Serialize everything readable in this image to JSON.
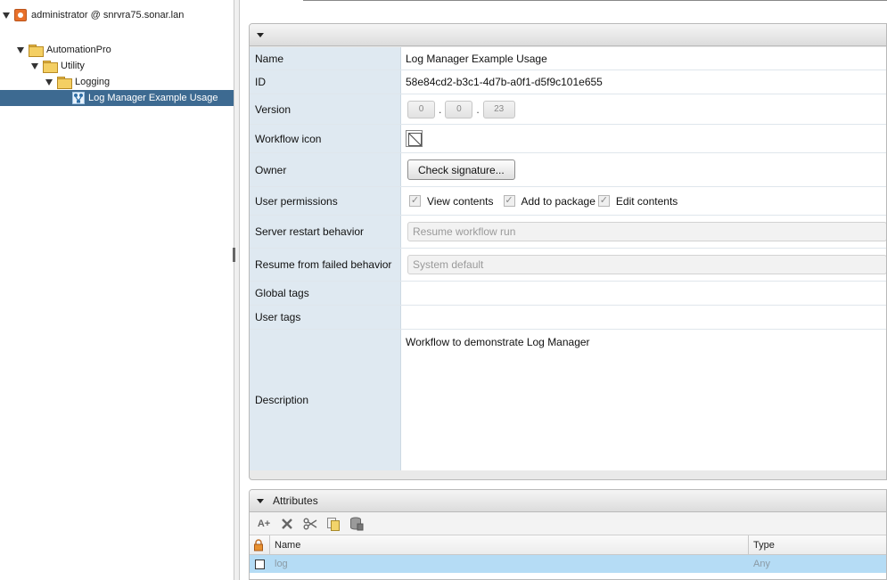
{
  "tree": {
    "root": "administrator @ snrvra75.sonar.lan",
    "items": [
      {
        "label": "AutomationPro"
      },
      {
        "label": "Utility"
      },
      {
        "label": "Logging"
      },
      {
        "label": "Log Manager Example Usage"
      }
    ]
  },
  "general": {
    "rows": [
      {
        "label": "Name",
        "value": "Log Manager Example Usage"
      },
      {
        "label": "ID",
        "value": "58e84cd2-b3c1-4d7b-a0f1-d5f9c101e655"
      },
      {
        "label": "Version"
      },
      {
        "label": "Workflow icon"
      },
      {
        "label": "Owner"
      },
      {
        "label": "User permissions"
      },
      {
        "label": "Server restart behavior"
      },
      {
        "label": "Resume from failed behavior"
      },
      {
        "label": "Global tags",
        "value": ""
      },
      {
        "label": "User tags",
        "value": ""
      },
      {
        "label": "Description",
        "value": "Workflow to demonstrate Log Manager"
      }
    ],
    "version": {
      "major": "0",
      "minor": "0",
      "build": "23",
      "sep": "."
    },
    "owner_button": "Check signature...",
    "permissions": [
      "View contents",
      "Add to package",
      "Edit contents"
    ],
    "check_mark": "✓",
    "server_restart_value": "Resume workflow run",
    "resume_failed_value": "System default"
  },
  "attributes": {
    "title": "Attributes",
    "toolbar": {
      "add_label": "A+"
    },
    "columns": [
      "Name",
      "Type"
    ],
    "rows": [
      {
        "name": "log",
        "type": "Any"
      }
    ]
  }
}
